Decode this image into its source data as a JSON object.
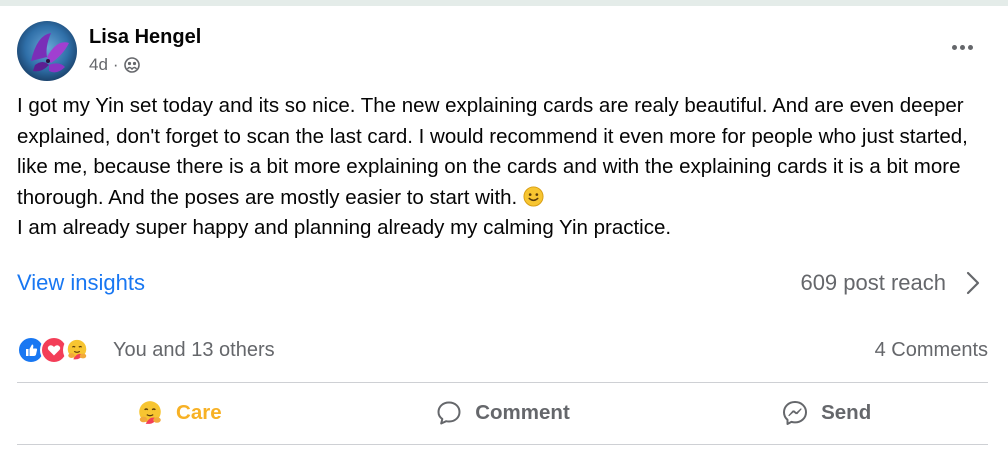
{
  "post": {
    "author": "Lisa Hengel",
    "time": "4d",
    "separator": "·",
    "audience_icon": "friends-icon",
    "more_icon": "more-dots-icon",
    "text": "I got my Yin set today and its so nice. The new explaining cards are realy beautiful. And are even deeper explained, don't forget to scan the last card. I would recommend it even more for people who just started, like me, because there is a bit more explaining on the cards and with the explaining cards it is a bit more thorough. And the poses are mostly easier to start with.",
    "text_line2": "I am already super happy and planning already my calming Yin practice.",
    "emoji": "smile-emoji-icon"
  },
  "insights": {
    "label": "View insights",
    "reach": "609 post reach"
  },
  "reactions": {
    "icons": [
      "like-icon",
      "love-icon",
      "care-icon"
    ],
    "summary": "You and 13 others",
    "comments": "4 Comments"
  },
  "actions": {
    "care": "Care",
    "comment": "Comment",
    "send": "Send"
  },
  "colors": {
    "link": "#1877f2",
    "secondary": "#65676b",
    "care": "#f7b125",
    "like": "#1877f2",
    "love": "#f33e58"
  }
}
